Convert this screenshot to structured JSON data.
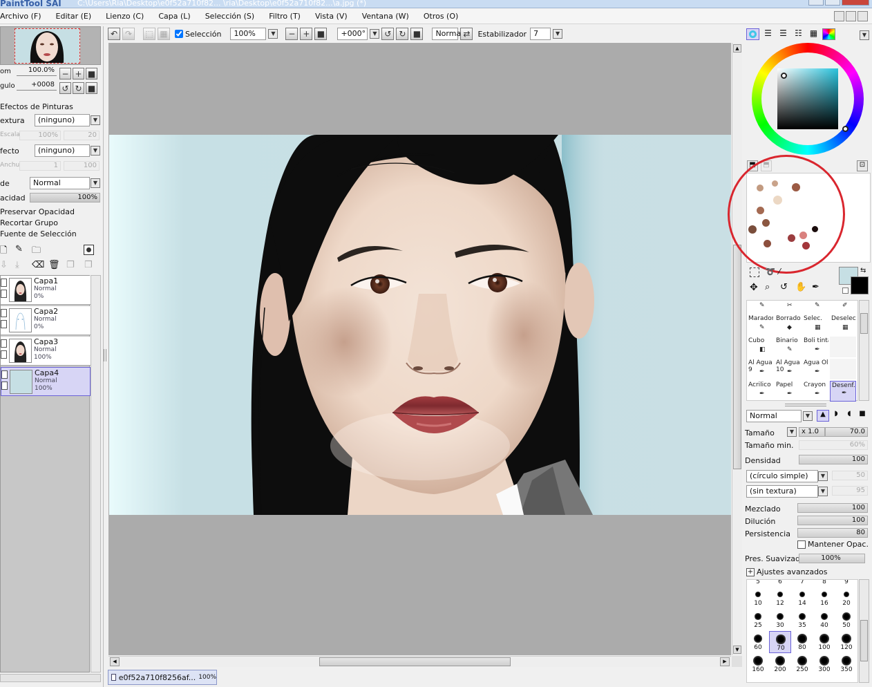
{
  "window": {
    "app_logo": "PaintTool SAI",
    "title": "C:\\Users\\Ria\\Desktop\\e0f52a710f82... \\ria\\Desktop\\e0f52a710f82...\\a.jpg (*)"
  },
  "menu": [
    "Archivo (F)",
    "Editar (E)",
    "Lienzo (C)",
    "Capa (L)",
    "Selección (S)",
    "Filtro (T)",
    "Vista (V)",
    "Ventana (W)",
    "Otros (O)"
  ],
  "toolbar": {
    "selection_label": "Selección",
    "zoom": "100%",
    "angle": "+000°",
    "mode": "Normal",
    "stabilizer_label": "Estabilizador",
    "stabilizer_value": "7"
  },
  "navigator": {
    "zoom_label": "om",
    "zoom_value": "100.0%",
    "angle_label": "gulo",
    "angle_value": "+0008"
  },
  "paint_effects": {
    "header": "Efectos de Pinturas",
    "texture_label": "extura",
    "texture_value": "(ninguno)",
    "scale_label": "Escalar",
    "scale_value": "100%",
    "scale_num": "20",
    "effect_label": "fecto",
    "effect_value": "(ninguno)",
    "width_label": "Anchura",
    "width_value": "1",
    "width_num": "100"
  },
  "layer_props": {
    "mode_label": "de",
    "mode_value": "Normal",
    "opacity_label": "acidad",
    "opacity_value": "100%",
    "preserve_opacity": "Preservar Opacidad",
    "clip_group": "Recortar Grupo",
    "selection_source": "Fuente de Selección"
  },
  "layers": [
    {
      "name": "Capa1",
      "mode": "Normal",
      "opacity": "0%"
    },
    {
      "name": "Capa2",
      "mode": "Normal",
      "opacity": "0%"
    },
    {
      "name": "Capa3",
      "mode": "Normal",
      "opacity": "100%"
    },
    {
      "name": "Capa4",
      "mode": "Normal",
      "opacity": "100%"
    }
  ],
  "doc_tab": {
    "name": "e0f52a710f8256af...",
    "zoom": "100%"
  },
  "tools": [
    {
      "name": "Marador"
    },
    {
      "name": "Borrador"
    },
    {
      "name": "Selec."
    },
    {
      "name": "Deselec."
    },
    {
      "name": "Cubo"
    },
    {
      "name": "Binario"
    },
    {
      "name": "Boli tinta"
    },
    {
      "name": ""
    },
    {
      "name": "Al Agua",
      "num": "9"
    },
    {
      "name": "Al Agua",
      "num": "10"
    },
    {
      "name": "Agua Ol"
    },
    {
      "name": ""
    },
    {
      "name": "Acrilico"
    },
    {
      "name": "Papel"
    },
    {
      "name": "Crayon"
    },
    {
      "name": "Desenf."
    }
  ],
  "brush": {
    "mode": "Normal",
    "size_label": "Tamaño",
    "size_mult": "x 1.0",
    "size_value": "70.0",
    "min_size_label": "Tamaño min.",
    "min_size_value": "60%",
    "density_label": "Densidad",
    "density_value": "100",
    "shape": "(círculo simple)",
    "shape_value": "50",
    "texture": "(sin textura)",
    "texture_value": "95",
    "blend_label": "Mezclado",
    "blend_value": "100",
    "dilution_label": "Dilución",
    "dilution_value": "100",
    "persist_label": "Persistencia",
    "persist_value": "80",
    "keep_opacity": "Mantener Opac.",
    "smooth_label": "Pres. Suavizado",
    "smooth_value": "100%",
    "advanced": "Ajustes avanzados"
  },
  "brush_sizes_top": [
    "5",
    "6",
    "7",
    "8",
    "9"
  ],
  "brush_sizes": [
    "10",
    "12",
    "14",
    "16",
    "20",
    "25",
    "30",
    "35",
    "40",
    "50",
    "60",
    "70",
    "80",
    "100",
    "120",
    "160",
    "200",
    "250",
    "300",
    "350"
  ],
  "colors": {
    "accent_selection": "#6a62d8",
    "annotation_circle": "#d9262e",
    "background_teal": "#c6dfe4",
    "lips": "#b54a4c",
    "hair": "#0d0d0d",
    "swatches": [
      "#b07f66",
      "#c99d85",
      "#9b5a44",
      "#e8cdb2",
      "#8b5741",
      "#7a4e3c",
      "#8c4f3d",
      "#9b3d3f",
      "#d9817e",
      "#a3363b",
      "#1a0c0c",
      "#865443"
    ]
  }
}
